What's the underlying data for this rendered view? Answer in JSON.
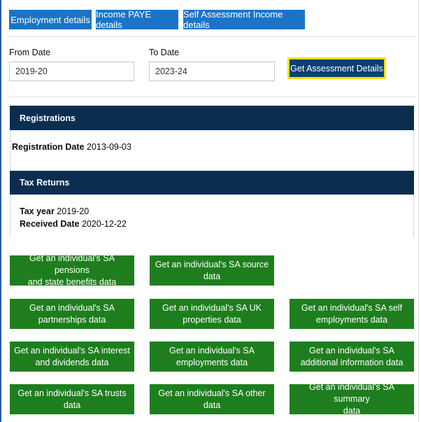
{
  "tabs": [
    {
      "label": "Employment details"
    },
    {
      "label": "Income PAYE details"
    },
    {
      "label": "Self Assessment Income details"
    }
  ],
  "filters": {
    "from_label": "From Date",
    "from_value": "2019-20",
    "to_label": "To Date",
    "to_value": "2023-24",
    "submit_label": "Get Assessment Details"
  },
  "registrations": {
    "heading": "Registrations",
    "date_label": "Registration Date",
    "date_value": "2013-09-03"
  },
  "tax_returns": {
    "heading": "Tax Returns",
    "year_label": "Tax year",
    "year_value": "2019-20",
    "received_label": "Received Date",
    "received_value": "2020-12-22"
  },
  "actions": [
    {
      "line1": "Get an individual's SA pensions",
      "line2": "and state benefits data"
    },
    {
      "line1": "Get an individual's SA source",
      "line2": "data"
    },
    {
      "line1": "Get an individual's SA",
      "line2": "partnerships data"
    },
    {
      "line1": "Get an individual's SA UK",
      "line2": "properties data"
    },
    {
      "line1": "Get an individual's SA self",
      "line2": "employments data"
    },
    {
      "line1": "Get an individual's SA interest",
      "line2": "and dividends data"
    },
    {
      "line1": "Get an individual's SA",
      "line2": "employments data"
    },
    {
      "line1": "Get an individual's SA",
      "line2": "additional information data"
    },
    {
      "line1": "Get an individual's SA trusts",
      "line2": "data"
    },
    {
      "line1": "Get an individual's SA other",
      "line2": "data"
    },
    {
      "line1": "Get an individual's SA summary",
      "line2": "data"
    }
  ],
  "colors": {
    "tab": "#1a75c9",
    "header": "#0b2d50",
    "action": "#1e7e1e",
    "focus": "#ffdd00"
  }
}
